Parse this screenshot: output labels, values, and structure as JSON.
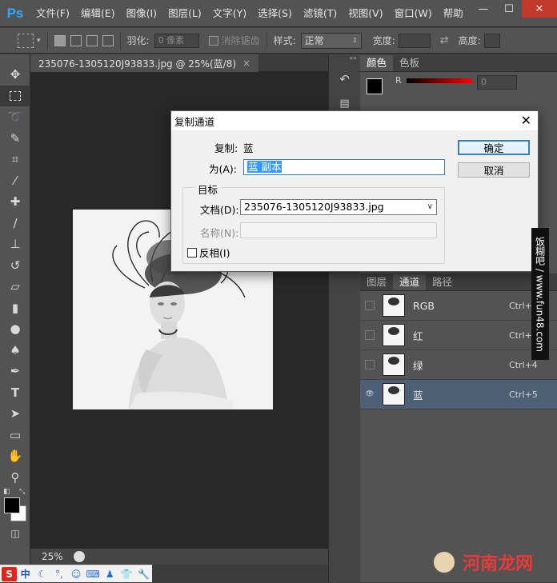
{
  "app": {
    "logo": "Ps"
  },
  "menu": [
    "文件(F)",
    "编辑(E)",
    "图像(I)",
    "图层(L)",
    "文字(Y)",
    "选择(S)",
    "滤镜(T)",
    "视图(V)",
    "窗口(W)",
    "帮助"
  ],
  "window_controls": {
    "minimize": "—",
    "maximize": "☐",
    "close": "✕"
  },
  "options_bar": {
    "feather_label": "羽化:",
    "feather_value": "0 像素",
    "antialias_label": "消除锯齿",
    "style_label": "样式:",
    "style_value": "正常",
    "width_label": "宽度:",
    "height_label": "高度:"
  },
  "document": {
    "tab_title": "235076-1305120J93833.jpg @ 25%(蓝/8)",
    "tab_close": "×",
    "zoom": "25%"
  },
  "color_panel": {
    "tabs": [
      "颜色",
      "色板"
    ],
    "r_label": "R",
    "r_value": "0"
  },
  "channels_panel": {
    "tabs": [
      "图层",
      "通道",
      "路径"
    ],
    "active_tab_index": 1,
    "rows": [
      {
        "name": "RGB",
        "shortcut": "Ctrl+2",
        "visible": false,
        "selected": false
      },
      {
        "name": "红",
        "shortcut": "Ctrl+3",
        "visible": false,
        "selected": false
      },
      {
        "name": "绿",
        "shortcut": "Ctrl+4",
        "visible": false,
        "selected": false
      },
      {
        "name": "蓝",
        "shortcut": "Ctrl+5",
        "visible": true,
        "selected": true
      }
    ]
  },
  "dialog": {
    "title": "复制通道",
    "close": "✕",
    "copy_label": "复制:",
    "copy_value": "蓝",
    "as_label": "为(A):",
    "as_value": "蓝 副本",
    "ok_label": "确定",
    "cancel_label": "取消",
    "target_group_label": "目标",
    "document_label": "文档(D):",
    "document_value": "235076-1305120J93833.jpg",
    "name_label": "名称(N):",
    "name_value": "",
    "invert_label": "反相(I)"
  },
  "watermark": {
    "vertical_text": "饭糊吧 / www.fun48.com",
    "bottom_text": "河南龙网"
  },
  "ime_bar": {
    "logo": "S",
    "mode": "中"
  }
}
